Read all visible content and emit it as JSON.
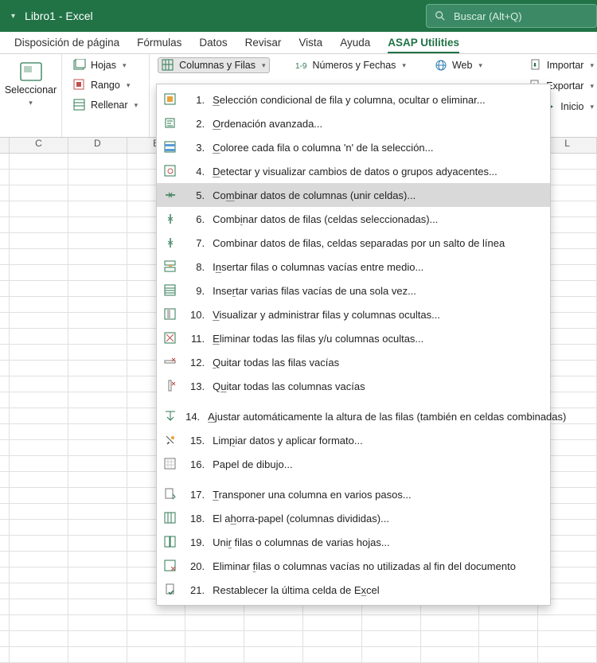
{
  "titlebar": {
    "title": "Libro1  -  Excel",
    "search_text": "Buscar (Alt+Q)"
  },
  "tabs": {
    "items": [
      {
        "label": "Disposición de página"
      },
      {
        "label": "Fórmulas"
      },
      {
        "label": "Datos"
      },
      {
        "label": "Revisar"
      },
      {
        "label": "Vista"
      },
      {
        "label": "Ayuda"
      },
      {
        "label": "ASAP Utilities",
        "active": true
      }
    ]
  },
  "ribbon": {
    "select_label": "Seleccionar",
    "hojas": "Hojas",
    "rango": "Rango",
    "rellenar": "Rellenar",
    "columnas_filas": "Columnas y Filas",
    "numeros_fechas": "Números y Fechas",
    "web": "Web",
    "importar": "Importar",
    "exportar": "Exportar",
    "inicio": "Inicio"
  },
  "menu": {
    "items": [
      {
        "n": "1.",
        "pre": "",
        "u": "S",
        "post": "elección condicional de fila y columna, ocultar o eliminar..."
      },
      {
        "n": "2.",
        "pre": "",
        "u": "O",
        "post": "rdenación avanzada..."
      },
      {
        "n": "3.",
        "pre": "",
        "u": "C",
        "post": "oloree cada fila o columna 'n' de la selección..."
      },
      {
        "n": "4.",
        "pre": "",
        "u": "D",
        "post": "etectar y visualizar cambios de datos o grupos adyacentes..."
      },
      {
        "n": "5.",
        "pre": "Co",
        "u": "m",
        "post": "binar datos de columnas (unir celdas)...",
        "hl": true
      },
      {
        "n": "6.",
        "pre": "Comb",
        "u": "i",
        "post": "nar datos de filas (celdas seleccionadas)..."
      },
      {
        "n": "7.",
        "pre": "Combinar datos de filas, celdas separadas por un salto de línea",
        "u": "",
        "post": ""
      },
      {
        "n": "8.",
        "pre": "I",
        "u": "n",
        "post": "sertar filas o columnas vacías entre medio..."
      },
      {
        "n": "9.",
        "pre": "Inse",
        "u": "r",
        "post": "tar varias filas vacías de una sola vez..."
      },
      {
        "n": "10.",
        "pre": "",
        "u": "V",
        "post": "isualizar y administrar filas y columnas ocultas..."
      },
      {
        "n": "11.",
        "pre": "",
        "u": "E",
        "post": "liminar todas las filas y/u columnas ocultas..."
      },
      {
        "n": "12.",
        "pre": "",
        "u": "Q",
        "post": "uitar todas las filas vacías"
      },
      {
        "n": "13.",
        "pre": "Q",
        "u": "u",
        "post": "itar todas las columnas vacías"
      },
      {
        "n": "14.",
        "pre": "",
        "u": "A",
        "post": "justar automáticamente la altura de las filas (también en celdas combinadas)"
      },
      {
        "n": "15.",
        "pre": "Lim",
        "u": "p",
        "post": "iar datos y aplicar formato..."
      },
      {
        "n": "16.",
        "pre": "Papel de dibu",
        "u": "j",
        "post": "o..."
      },
      {
        "n": "17.",
        "pre": "",
        "u": "T",
        "post": "ransponer una columna en varios pasos..."
      },
      {
        "n": "18.",
        "pre": "El a",
        "u": "h",
        "post": "orra-papel (columnas divididas)..."
      },
      {
        "n": "19.",
        "pre": "Uni",
        "u": "r",
        "post": " filas o columnas de varias hojas..."
      },
      {
        "n": "20.",
        "pre": "Eliminar ",
        "u": "f",
        "post": "ilas o columnas vacías no utilizadas al fin del documento"
      },
      {
        "n": "21.",
        "pre": "Restablecer la última celda de E",
        "u": "x",
        "post": "cel"
      }
    ]
  },
  "columns": [
    "C",
    "D",
    "E",
    "",
    "",
    "",
    "",
    "",
    "",
    "L"
  ]
}
